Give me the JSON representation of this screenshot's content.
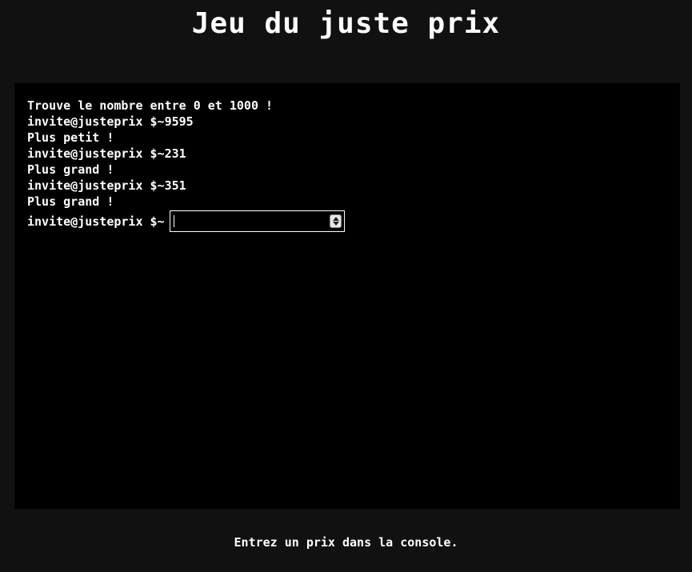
{
  "title": "Jeu du juste prix",
  "console": {
    "lines": [
      "Trouve le nombre entre 0 et 1000 !",
      "invite@justeprix $~9595",
      "Plus petit !",
      "invite@justeprix $~231",
      "Plus grand !",
      "invite@justeprix $~351",
      "Plus grand !"
    ],
    "prompt": "invite@justeprix $~",
    "input_value": ""
  },
  "footer": "Entrez un prix dans la console.",
  "colors": {
    "page_background": "#111111",
    "console_background": "#000000",
    "text": "#ffffff"
  }
}
